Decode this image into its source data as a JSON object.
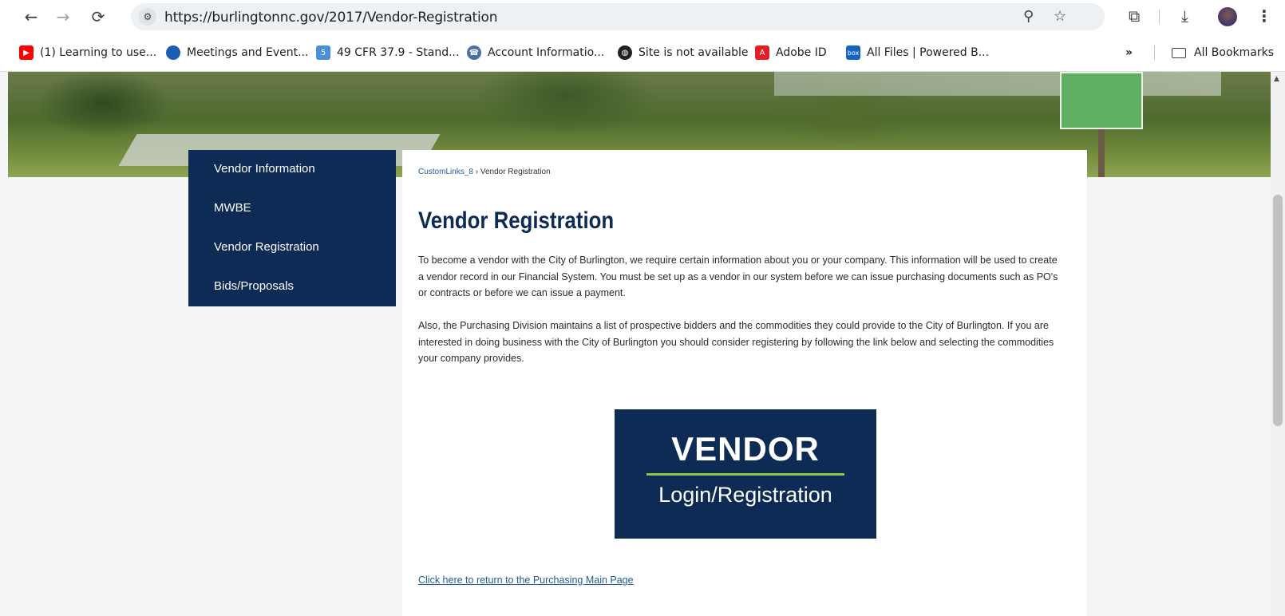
{
  "browser": {
    "url": "https://burlingtonnc.gov/2017/Vendor-Registration",
    "icons": {
      "back": "arrow-left-icon",
      "forward": "arrow-right-icon",
      "reload": "reload-icon",
      "site_info": "tune-icon",
      "zoom": "zoom-icon",
      "star": "star-icon",
      "extensions": "puzzle-icon",
      "download": "download-icon",
      "profile": "avatar",
      "menu": "kebab-menu-icon"
    }
  },
  "bookmarks": {
    "items": [
      {
        "label": "(1) Learning to use...",
        "icon": "youtube-icon",
        "color": "#ff0000"
      },
      {
        "label": "Meetings and Event...",
        "icon": "globe-seal-icon",
        "color": "#1a5fb4"
      },
      {
        "label": "49 CFR 37.9 - Stand...",
        "icon": "document-icon",
        "color": "#4a90d9"
      },
      {
        "label": "Account Informatio...",
        "icon": "phone-icon",
        "color": "#4a6fa5"
      },
      {
        "label": "Site is not available",
        "icon": "globe-icon",
        "color": "#202124"
      },
      {
        "label": "Adobe ID",
        "icon": "adobe-icon",
        "color": "#e31e24"
      },
      {
        "label": "All Files | Powered B...",
        "icon": "box-icon",
        "color": "#1565c0"
      }
    ],
    "overflow": "»",
    "all_bookmarks": "All Bookmarks"
  },
  "sidenav": {
    "items": [
      {
        "label": "Vendor Information"
      },
      {
        "label": "MWBE"
      },
      {
        "label": "Vendor Registration"
      },
      {
        "label": "Bids/Proposals"
      }
    ]
  },
  "breadcrumb": {
    "parent": "CustomLinks_8",
    "separator": "›",
    "current": "Vendor Registration"
  },
  "main": {
    "title": "Vendor Registration",
    "paragraph1": "To become a vendor with the City of Burlington, we require certain information about you or your company. This information will be used to create a vendor record in our Financial System. You must be set up as a vendor in our system before we can issue purchasing documents such as PO's or contracts or before we can issue a payment.",
    "paragraph2": "Also, the Purchasing Division maintains a list of prospective bidders and the commodities they could provide to the City of Burlington. If you are interested in doing business with the City of Burlington you should consider registering by following the link below and selecting the commodities your company provides.",
    "banner_title": "VENDOR",
    "banner_subtitle": "Login/Registration",
    "return_link": "Click here to return to the Purchasing Main Page"
  },
  "colors": {
    "navy": "#0d2b55",
    "accent_green": "#8dc63f",
    "link": "#1f5c99"
  }
}
